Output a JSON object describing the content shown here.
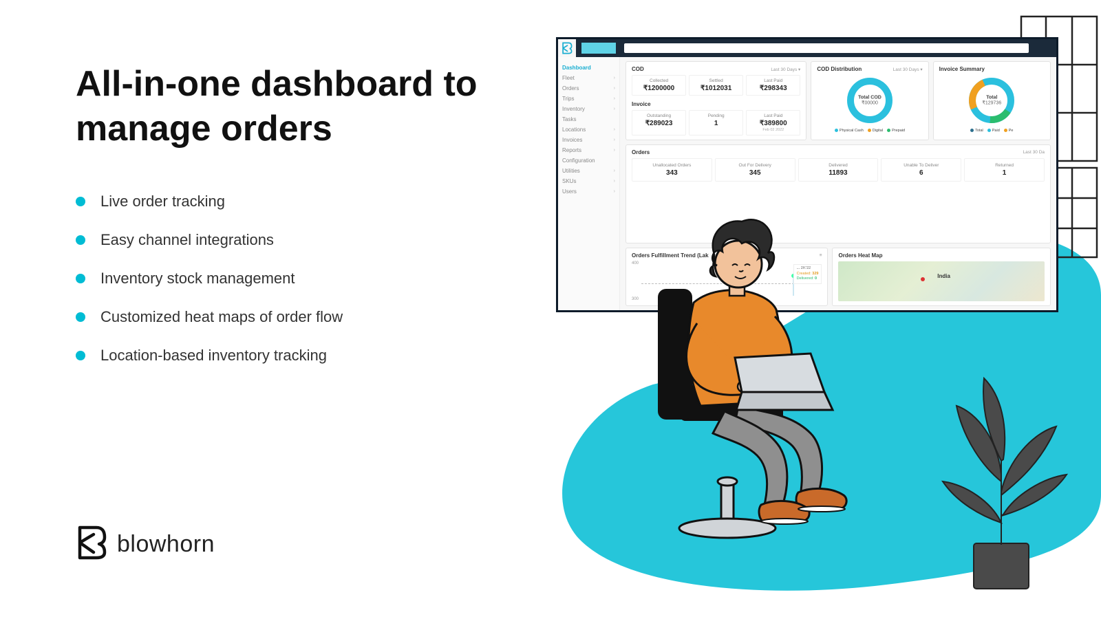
{
  "headline": "All-in-one dashboard to manage orders",
  "features": [
    "Live order tracking",
    "Easy channel integrations",
    "Inventory stock management",
    "Customized heat maps of order flow",
    "Location-based inventory tracking"
  ],
  "brand": "blowhorn",
  "sidebar": {
    "items": [
      "Dashboard",
      "Fleet",
      "Orders",
      "Trips",
      "Inventory",
      "Tasks",
      "Locations",
      "Invoices",
      "Reports",
      "Configuration",
      "Utilities",
      "SKUs",
      "Users"
    ]
  },
  "dashboard": {
    "cod": {
      "title": "COD",
      "range": "Last 30 Days",
      "stats": [
        {
          "label": "Collected",
          "value": "₹1200000"
        },
        {
          "label": "Settled",
          "value": "₹1012031"
        },
        {
          "label": "Last Paid",
          "value": "₹298343"
        }
      ]
    },
    "invoice": {
      "title": "Invoice",
      "stats": [
        {
          "label": "Outstanding",
          "value": "₹289023"
        },
        {
          "label": "Pending",
          "value": "1"
        },
        {
          "label": "Last Paid",
          "value": "₹389800",
          "sub": "Feb 02 2022"
        }
      ]
    },
    "cod_dist": {
      "title": "COD Distribution",
      "range": "Last 30 Days",
      "center_title": "Total COD",
      "center_value": "₹00000",
      "legend": [
        "Physical Cash",
        "Digital",
        "Prepaid"
      ]
    },
    "invoice_summary": {
      "title": "Invoice Summary",
      "center_title": "Total",
      "center_value": "₹129736",
      "legend": [
        "Total",
        "Paid",
        "Pe"
      ]
    },
    "orders": {
      "title": "Orders",
      "range": "Last 30 Da",
      "stats": [
        {
          "label": "Unallocated Orders",
          "value": "343"
        },
        {
          "label": "Out For Delivery",
          "value": "345"
        },
        {
          "label": "Delivered",
          "value": "11893"
        },
        {
          "label": "Unable To Deliver",
          "value": "6"
        },
        {
          "label": "Returned",
          "value": "1"
        }
      ]
    },
    "trend": {
      "title": "Orders Fulfillment Trend (Lak",
      "y": [
        "400",
        "300"
      ],
      "tooltip_header": "... 2K'22",
      "tooltip_created_label": "Created:",
      "tooltip_created": "329",
      "tooltip_delivered_label": "Delivered:",
      "tooltip_delivered": "0"
    },
    "heatmap": {
      "title": "Orders Heat Map",
      "country": "India"
    }
  }
}
